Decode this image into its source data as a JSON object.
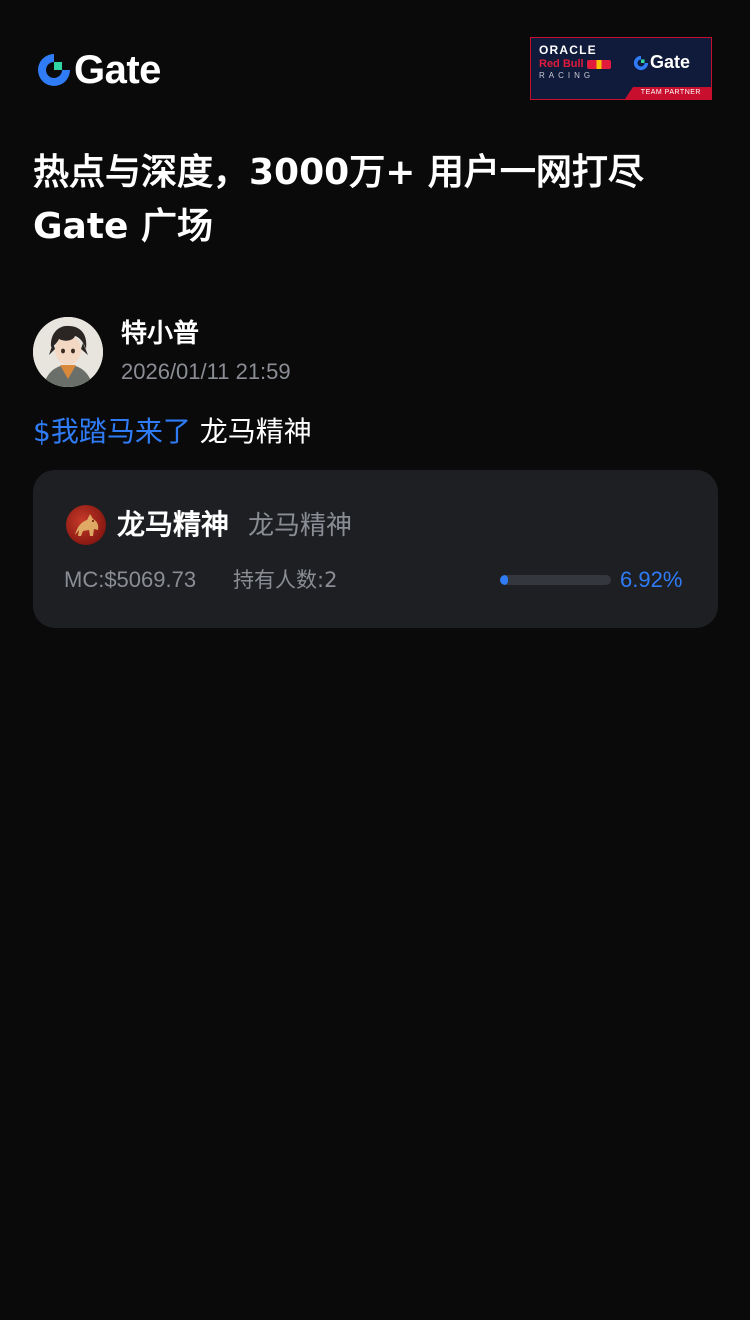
{
  "header": {
    "logo_text": "Gate",
    "partner": {
      "oracle": "ORACLE",
      "redbull": "Red Bull",
      "racing": "RACING",
      "gate": "Gate",
      "team_partner": "TEAM PARTNER"
    }
  },
  "headline": {
    "line1": "热点与深度，3000万+ 用户一网打尽",
    "line2": "Gate 广场"
  },
  "post": {
    "author": "特小普",
    "timestamp": "2026/01/11 21:59",
    "tag": "$我踏马来了",
    "text": " 龙马精神"
  },
  "token_card": {
    "name": "龙马精神",
    "symbol": "龙马精神",
    "market_cap": "MC:$5069.73",
    "holders": "持有人数:2",
    "progress_label": "6.92%",
    "progress_fraction": 0.0692
  },
  "colors": {
    "background": "#0a0a0b",
    "card": "#1d1f23",
    "accent": "#2f7cf6",
    "muted_text": "#8a8d94"
  }
}
